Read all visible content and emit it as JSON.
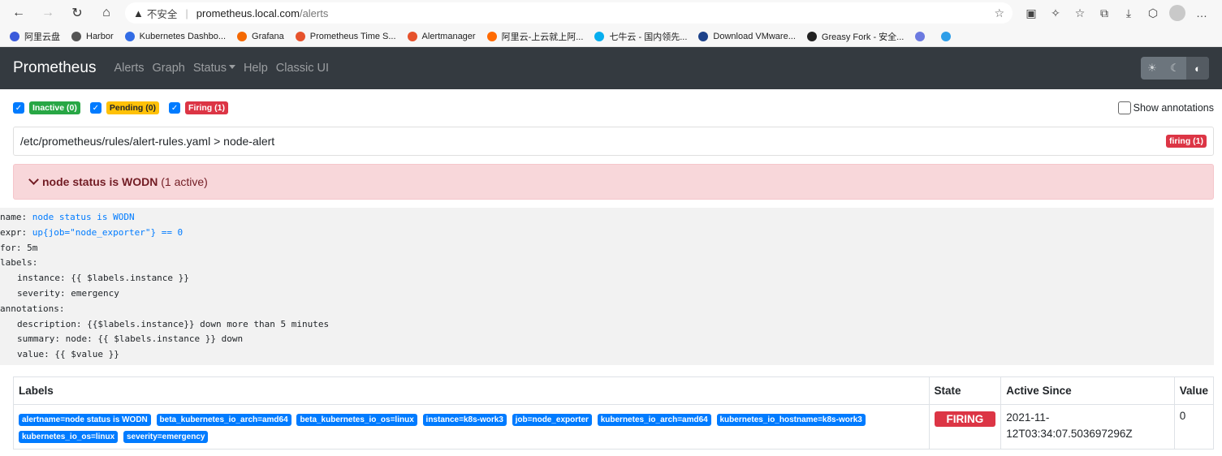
{
  "browser": {
    "insecure": "不安全",
    "url_host": "prometheus.local.com",
    "url_path": "/alerts",
    "bookmarks": [
      {
        "label": "阿里云盘",
        "color": "#3b5bdb"
      },
      {
        "label": "Harbor",
        "color": "#555555"
      },
      {
        "label": "Kubernetes Dashbo...",
        "color": "#326ce5"
      },
      {
        "label": "Grafana",
        "color": "#f46800"
      },
      {
        "label": "Prometheus Time S...",
        "color": "#e6522c"
      },
      {
        "label": "Alertmanager",
        "color": "#e6522c"
      },
      {
        "label": "阿里云-上云就上阿...",
        "color": "#ff6a00"
      },
      {
        "label": "七牛云 - 国内领先...",
        "color": "#06aeef"
      },
      {
        "label": "Download VMware...",
        "color": "#1d428a"
      },
      {
        "label": "Greasy Fork - 安全...",
        "color": "#222222"
      },
      {
        "label": "",
        "color": "#6c7ae0"
      },
      {
        "label": "",
        "color": "#2f9ee8"
      }
    ]
  },
  "nav": {
    "brand": "Prometheus",
    "links": [
      "Alerts",
      "Graph",
      "Status",
      "Help",
      "Classic UI"
    ]
  },
  "filters": {
    "inactive": "Inactive (0)",
    "pending": "Pending (0)",
    "firing": "Firing (1)",
    "show_annotations": "Show annotations"
  },
  "rule_file": {
    "path": "/etc/prometheus/rules/alert-rules.yaml > node-alert",
    "badge": "firing (1)"
  },
  "alert": {
    "name": "node status is WODN",
    "count": "(1 active)"
  },
  "rule_def": {
    "name_key": "name: ",
    "name_val": "node status is WODN",
    "expr_key": "expr: ",
    "expr_val": "up{job=\"node_exporter\"} == 0",
    "for": "for: 5m",
    "labels": "labels:",
    "instance": "instance: {{ $labels.instance }}",
    "severity": "severity: emergency",
    "annotations": "annotations:",
    "description": "description: {{$labels.instance}} down more than 5 minutes",
    "summary": "summary: node: {{ $labels.instance }} down",
    "value": "value: {{ $value }}"
  },
  "table": {
    "headers": [
      "Labels",
      "State",
      "Active Since",
      "Value"
    ],
    "row": {
      "labels": [
        "alertname=node status is WODN",
        "beta_kubernetes_io_arch=amd64",
        "beta_kubernetes_io_os=linux",
        "instance=k8s-work3",
        "job=node_exporter",
        "kubernetes_io_arch=amd64",
        "kubernetes_io_hostname=k8s-work3",
        "kubernetes_io_os=linux",
        "severity=emergency"
      ],
      "state": "FIRING",
      "since_line1": "2021-11-",
      "since_line2": "12T03:34:07.503697296Z",
      "value": "0"
    }
  }
}
